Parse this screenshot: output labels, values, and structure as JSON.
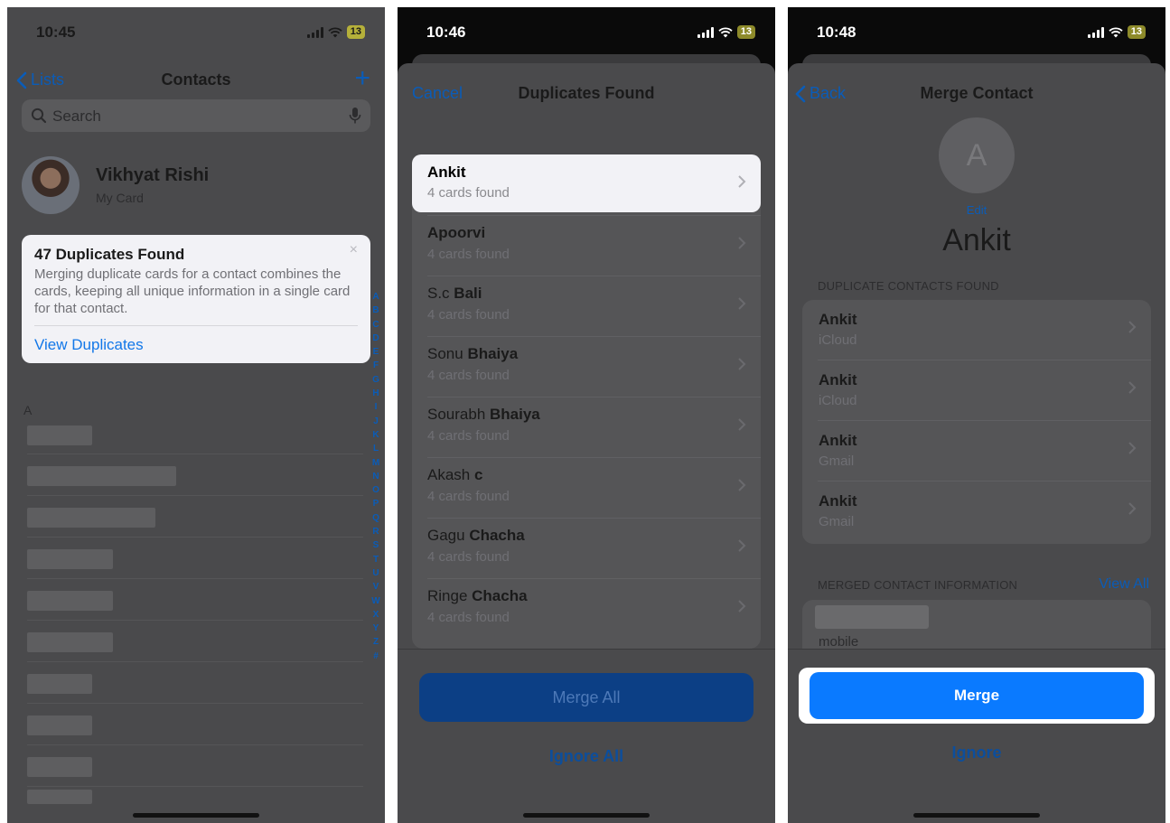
{
  "phone1": {
    "time": "10:45",
    "battery": "13",
    "nav": {
      "back": "Lists",
      "title": "Contacts",
      "add": "+"
    },
    "search": {
      "placeholder": "Search"
    },
    "my_card": {
      "name": "Vikhyat Rishi",
      "label": "My Card"
    },
    "duplicates_banner": {
      "title": "47 Duplicates Found",
      "body": "Merging duplicate cards for a contact combines the cards, keeping all unique information in a single card for that contact.",
      "close": "×",
      "action": "View Duplicates"
    },
    "section_letter": "A",
    "index_letters": [
      "A",
      "B",
      "C",
      "D",
      "E",
      "F",
      "G",
      "H",
      "I",
      "J",
      "K",
      "L",
      "M",
      "N",
      "O",
      "P",
      "Q",
      "R",
      "S",
      "T",
      "U",
      "V",
      "W",
      "X",
      "Y",
      "Z",
      "#"
    ]
  },
  "phone2": {
    "time": "10:46",
    "battery": "13",
    "nav": {
      "cancel": "Cancel",
      "title": "Duplicates Found"
    },
    "highlighted": {
      "name": "Ankit",
      "count": "4 cards found"
    },
    "items": [
      {
        "first": "",
        "last": "Apoorvi",
        "count": "4 cards found"
      },
      {
        "first": "S.c ",
        "last": "Bali",
        "count": "4 cards found"
      },
      {
        "first": "Sonu ",
        "last": "Bhaiya",
        "count": "4 cards found"
      },
      {
        "first": "Sourabh ",
        "last": "Bhaiya",
        "count": "4 cards found"
      },
      {
        "first": "Akash ",
        "last": "c",
        "count": "4 cards found"
      },
      {
        "first": "Gagu ",
        "last": "Chacha",
        "count": "4 cards found"
      },
      {
        "first": "Ringe ",
        "last": "Chacha",
        "count": "4 cards found"
      }
    ],
    "merge_all": "Merge All",
    "ignore_all": "Ignore All"
  },
  "phone3": {
    "time": "10:48",
    "battery": "13",
    "nav": {
      "back": "Back",
      "title": "Merge Contact"
    },
    "avatar_initial": "A",
    "edit": "Edit",
    "name": "Ankit",
    "duplicates_header": "DUPLICATE CONTACTS FOUND",
    "duplicates": [
      {
        "name": "Ankit",
        "source": "iCloud"
      },
      {
        "name": "Ankit",
        "source": "iCloud"
      },
      {
        "name": "Ankit",
        "source": "Gmail"
      },
      {
        "name": "Ankit",
        "source": "Gmail"
      }
    ],
    "merged_header": "MERGED CONTACT INFORMATION",
    "view_all": "View All",
    "merged_label": "mobile",
    "merge": "Merge",
    "ignore": "Ignore"
  },
  "colors": {
    "accent": "#0a7aff",
    "link": "#1277e8",
    "dim_overlay": "#4a4a4c"
  }
}
